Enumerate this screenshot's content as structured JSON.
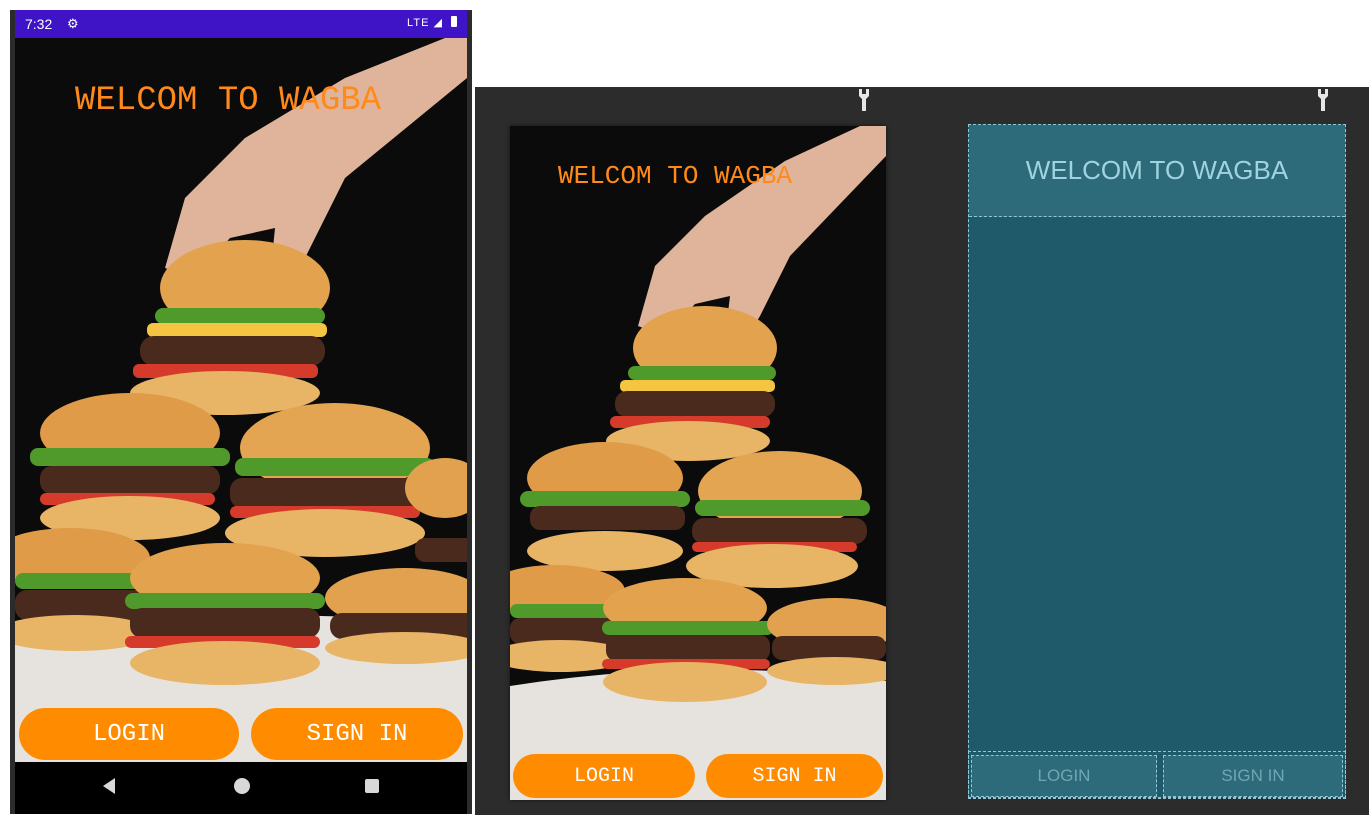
{
  "status_bar": {
    "time": "7:32",
    "signal": "LTE"
  },
  "screen": {
    "title": "WELCOM TO WAGBA",
    "login_label": "LOGIN",
    "signin_label": "SIGN IN"
  },
  "design_preview": {
    "title": "WELCOM TO WAGBA",
    "login_label": "LOGIN",
    "signin_label": "SIGN IN"
  },
  "blueprint": {
    "title": "WELCOM TO WAGBA",
    "login_label": "LOGIN",
    "signin_label": "SIGN IN"
  },
  "colors": {
    "status_bar": "#3f14c6",
    "accent_orange": "#ff8c00",
    "blueprint_bg": "#1f5a6a",
    "editor_bg": "#2c2c2c"
  },
  "icons": [
    "settings-gear-icon",
    "battery-icon",
    "back-icon",
    "home-icon",
    "recent-apps-icon",
    "wrench-icon"
  ]
}
